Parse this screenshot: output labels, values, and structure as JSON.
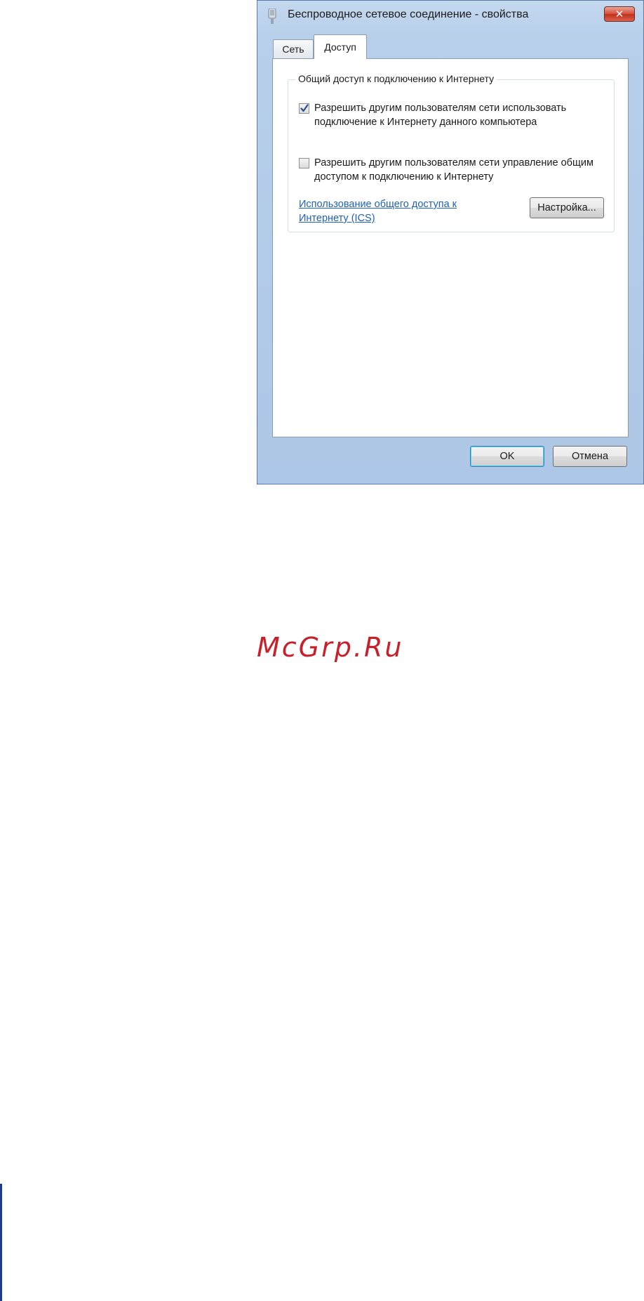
{
  "window": {
    "title": "Беспроводное сетевое соединение - свойства",
    "title_icon": "network-adapter-icon",
    "close_glyph": "✕"
  },
  "tabs": [
    {
      "label": "Сеть",
      "selected": false
    },
    {
      "label": "Доступ",
      "selected": true
    }
  ],
  "sharing_group": {
    "legend": "Общий доступ к подключению к Интернету",
    "options": [
      {
        "label": "Разрешить другим пользователям сети использовать подключение к Интернету данного компьютера",
        "checked": true
      },
      {
        "label": "Разрешить другим пользователям сети управление общим доступом к подключению к Интернету",
        "checked": false
      }
    ],
    "help_link": "Использование общего доступа к Интернету (ICS)",
    "settings_button": "Настройка..."
  },
  "footer": {
    "ok_label": "OK",
    "cancel_label": "Отмена"
  },
  "watermark": "McGrp.Ru",
  "colors": {
    "link": "#1d62b8",
    "close_button": "#c0301c",
    "watermark": "#c8202a"
  }
}
